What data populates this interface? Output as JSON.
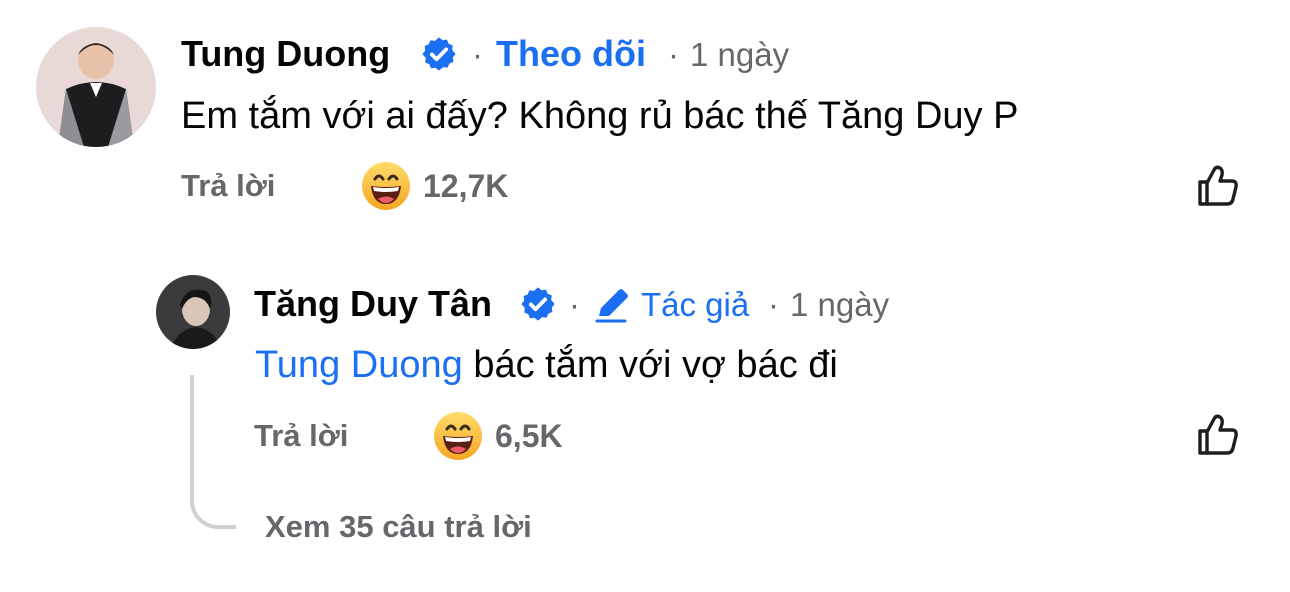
{
  "comment": {
    "author": "Tung Duong",
    "follow_label": "Theo dõi",
    "dot": "·",
    "time": "1 ngày",
    "text": "Em tắm với ai đấy? Không rủ bác thế Tăng Duy P",
    "reply_label": "Trả lời",
    "reaction_icon": "haha-emoji-icon",
    "reaction_count": "12,7K",
    "like_icon": "thumbs-up-icon",
    "verified_icon": "verified-badge-icon"
  },
  "reply": {
    "author": "Tăng Duy Tân",
    "dot": "·",
    "author_badge_label": "Tác giả",
    "author_badge_icon": "pencil-icon",
    "time": "1 ngày",
    "mention": "Tung Duong",
    "text": "bác tắm với vợ bác đi",
    "reply_label": "Trả lời",
    "reaction_icon": "haha-emoji-icon",
    "reaction_count": "6,5K",
    "like_icon": "thumbs-up-icon",
    "verified_icon": "verified-badge-icon"
  },
  "view_replies": "Xem 35 câu trả lời",
  "colors": {
    "link_blue": "#1b6ff2",
    "secondary_text": "#65676b",
    "primary_text": "#050505",
    "thread_line": "#ced0d4"
  }
}
